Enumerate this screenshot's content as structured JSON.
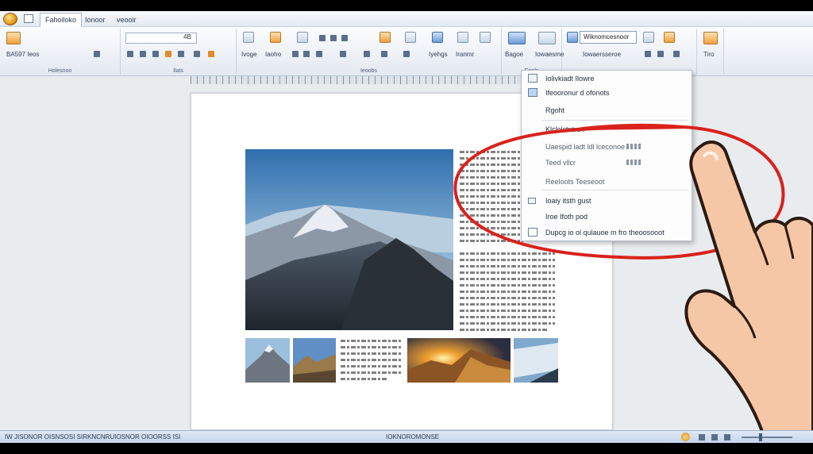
{
  "tabs": [
    {
      "label": "Fahoiloko",
      "active": true
    },
    {
      "label": "Ionoor",
      "active": false
    },
    {
      "label": "veooir",
      "active": false
    }
  ],
  "ribbon": {
    "font_field": "",
    "font_size": "4B",
    "left_caption": "BA597 Ieos",
    "group_labels": [
      "Holesnoo",
      "Ilats",
      "Ieoobs",
      "Enols"
    ],
    "labels_row": [
      "Ivoge",
      "Iaoho",
      "Iyehgs",
      "Iranmr",
      "Bagoe",
      "Iowaesme",
      "Iaoho",
      "Iowaersseroe",
      "Tiro"
    ],
    "styles_box": "Wiknomcesnoor"
  },
  "context_menu": {
    "items": [
      {
        "label": "Iolivkiadt Ilowre",
        "icon": "table-icon"
      },
      {
        "label": "Ifeooronur d ofonots",
        "icon": "picture-icon"
      },
      {
        "label": "Rgoht",
        "icon": ""
      },
      {
        "label": "Klclolctntron",
        "icon": ""
      },
      {
        "label": "Uaespid ladt ldl lceconoe",
        "icon": "",
        "dim": true,
        "shortcut": true
      },
      {
        "label": "Teed vllcr",
        "icon": "",
        "dim": true,
        "shortcut": true
      },
      {
        "label": "Reeloots Teeseoot",
        "icon": "",
        "dim": true
      },
      {
        "label": "Ioaiy itsth gust",
        "icon": "insert-icon"
      },
      {
        "label": "Iroe Ifoth pod",
        "icon": ""
      },
      {
        "label": "Dupcg io ol qulauoe m fro theoosooot",
        "icon": "window-icon"
      }
    ]
  },
  "status": {
    "left_text": "IW JISONOR OISNSOSI SIRKNCNRUIOSNOR OIOORSS ISI",
    "center_text": "IOKNOROMONSE"
  },
  "colors": {
    "annotation_red": "#d9221c",
    "ribbon_bg": "#e3e9f1",
    "hand_skin": "#f6c7a6"
  }
}
